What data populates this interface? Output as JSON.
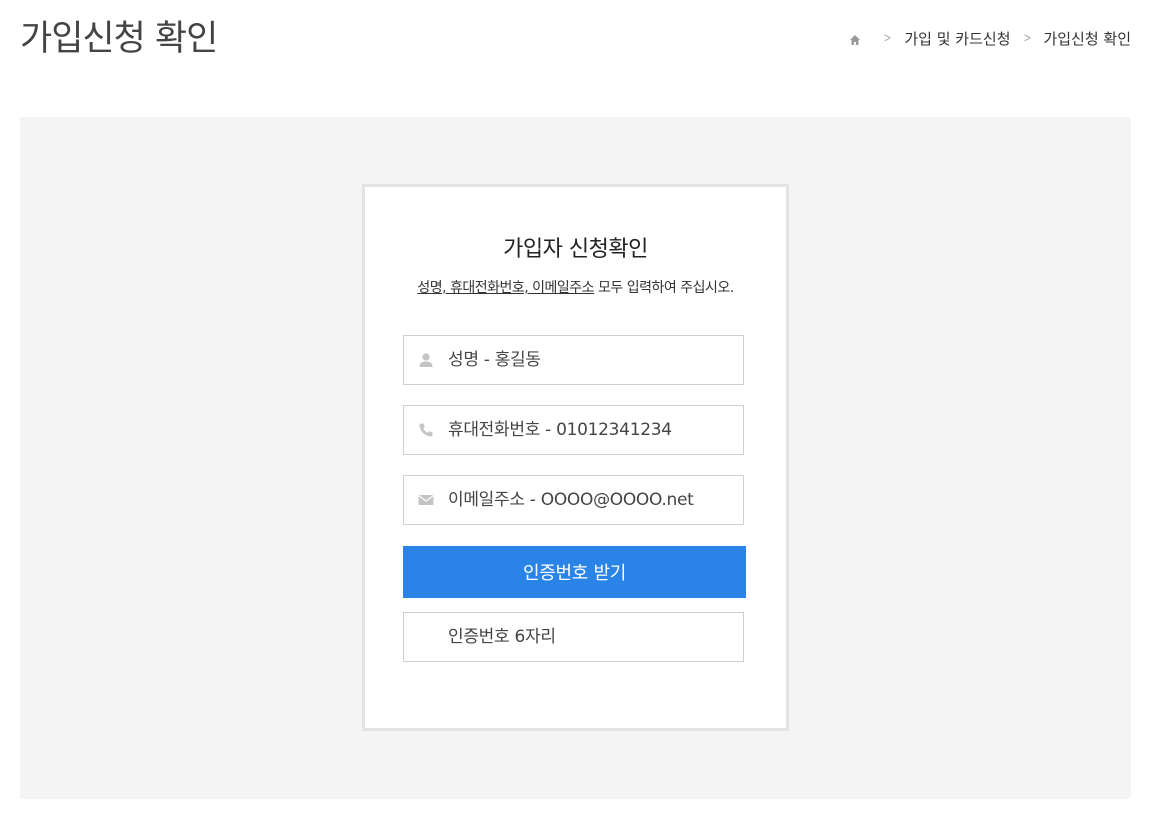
{
  "header": {
    "title": "가입신청 확인"
  },
  "breadcrumb": {
    "home_icon": "home-icon",
    "items": [
      "가입 및 카드신청",
      "가입신청 확인"
    ],
    "separator": ">"
  },
  "card": {
    "title": "가입자 신청확인",
    "desc_underlined": "성명, 휴대전화번호, 이메일주소",
    "desc_rest": " 모두 입력하여 주십시오.",
    "fields": {
      "name": {
        "icon": "person-icon",
        "placeholder": "성명 - 홍길동"
      },
      "phone": {
        "icon": "phone-icon",
        "placeholder": "휴대전화번호 - 01012341234"
      },
      "email": {
        "icon": "envelope-icon",
        "placeholder": "이메일주소 - OOOO@OOOO.net"
      },
      "code": {
        "placeholder": "인증번호 6자리"
      }
    },
    "submit_label": "인증번호 받기"
  },
  "colors": {
    "accent": "#2a84e7",
    "panel_bg": "#f4f4f4",
    "card_border": "#e3e3e3",
    "icon": "#c4c4c4"
  }
}
